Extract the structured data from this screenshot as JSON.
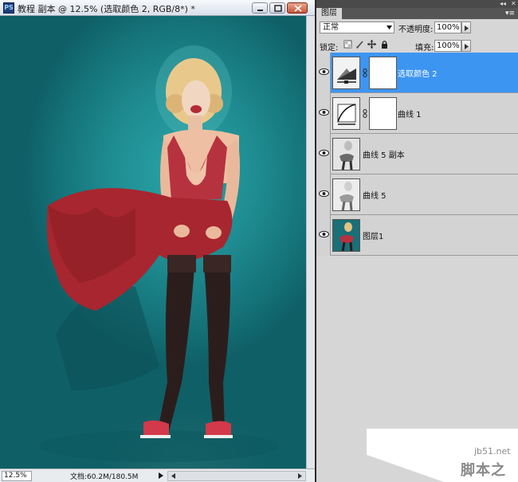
{
  "document": {
    "title": "教程 副本 @ 12.5% (选取颜色 2, RGB/8*) *",
    "app_icon": "PS",
    "zoom": "12.5%",
    "doc_info": "文档:60.2M/180.5M"
  },
  "layers_panel": {
    "tab_label": "图层",
    "blend_mode": "正常",
    "opacity_label": "不透明度:",
    "opacity_value": "100%",
    "lock_label": "锁定:",
    "fill_label": "填充:",
    "fill_value": "100%",
    "layers": [
      {
        "name": "选取颜色 2",
        "type": "adjustment-selective-color",
        "selected": true,
        "visible": true
      },
      {
        "name": "曲线 1",
        "type": "adjustment-curves",
        "selected": false,
        "visible": true
      },
      {
        "name": "曲线 5 副本",
        "type": "image",
        "selected": false,
        "visible": true
      },
      {
        "name": "曲线 5",
        "type": "image",
        "selected": false,
        "visible": true
      },
      {
        "name": "图层1",
        "type": "image",
        "selected": false,
        "visible": true
      }
    ]
  },
  "watermark": {
    "line1": "jb51.net",
    "line2": "脚本之家"
  },
  "colors": {
    "selection": "#3d95f2",
    "canvas_teal": "#1f8d92",
    "dress_red": "#b7323f"
  }
}
